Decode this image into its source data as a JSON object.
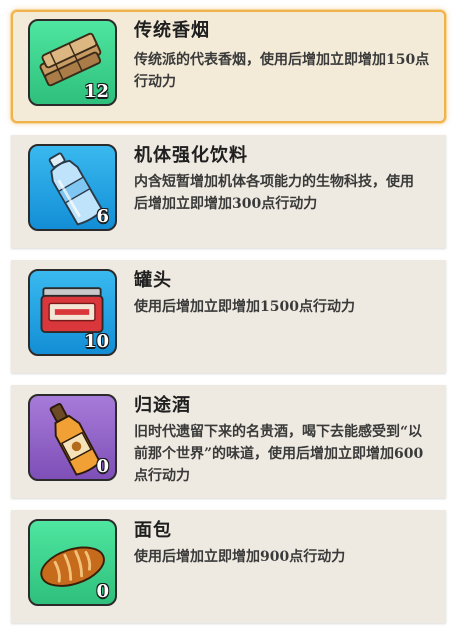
{
  "items": [
    {
      "name": "传统香烟",
      "desc": "传统派的代表香烟，使用后增加立即增加150点行动力",
      "count": "12",
      "icon": "cigarettes-icon",
      "tile_color": "#3ed290",
      "selected": true
    },
    {
      "name": "机体强化饮料",
      "desc": "内含短暂增加机体各项能力的生物科技，使用后增加立即增加300点行动力",
      "count": "6",
      "icon": "water-bottle-icon",
      "tile_color": "#1fa3e3",
      "selected": false
    },
    {
      "name": "罐头",
      "desc": "使用后增加立即增加1500点行动力",
      "count": "10",
      "icon": "canned-food-icon",
      "tile_color": "#1fa3e3",
      "selected": false
    },
    {
      "name": "归途酒",
      "desc": "旧时代遗留下来的名贵酒，喝下去能感受到“以前那个世界”的味道，使用后增加立即增加600点行动力",
      "count": "0",
      "icon": "liquor-bottle-icon",
      "tile_color": "#9566c9",
      "selected": false
    },
    {
      "name": "面包",
      "desc": "使用后增加立即增加900点行动力",
      "count": "0",
      "icon": "bread-icon",
      "tile_color": "#3ed290",
      "selected": false
    }
  ]
}
